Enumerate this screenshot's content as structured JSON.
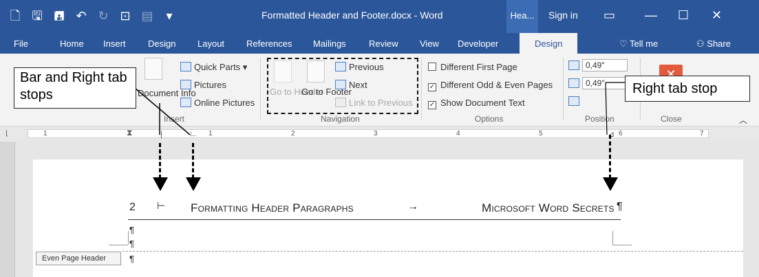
{
  "titlebar": {
    "doc_title": "Formatted Header and Footer.docx - Word",
    "context_tab": "Hea...",
    "sign_in": "Sign in"
  },
  "tabs": [
    "File",
    "Home",
    "Insert",
    "Design",
    "Layout",
    "References",
    "Mailings",
    "Review",
    "View",
    "Developer",
    "Design"
  ],
  "tell_me": "Tell me",
  "share": "Share",
  "ribbon": {
    "insert_group": {
      "doc_info": "Document Info",
      "quick_parts": "Quick Parts",
      "pictures": "Pictures",
      "online_pictures": "Online Pictures",
      "label": "Insert"
    },
    "navigation_group": {
      "go_to_header": "Go to Header",
      "go_to_footer": "Go to Footer",
      "previous": "Previous",
      "next": "Next",
      "link_to_previous": "Link to Previous",
      "label": "Navigation"
    },
    "options_group": {
      "different_first_page": "Different First Page",
      "different_odd_even": "Different Odd & Even Pages",
      "show_document_text": "Show Document Text",
      "different_first_page_checked": false,
      "different_odd_even_checked": true,
      "show_document_text_checked": true,
      "label": "Options"
    },
    "position_group": {
      "header_from_top": "0,49\"",
      "footer_from_bottom": "0,49\"",
      "label": "Position"
    },
    "close_group": {
      "label": "Close"
    }
  },
  "callouts": {
    "bar_right": "Bar and Right tab stops",
    "right": "Right tab stop"
  },
  "ruler_numbers": [
    "1",
    "1",
    "2",
    "3",
    "4",
    "5",
    "6",
    "7"
  ],
  "document": {
    "page_number": "2",
    "header_left": "Formatting Header Paragraphs",
    "header_right": "Microsoft Word Secrets",
    "pilcrow": "¶",
    "even_page_header_label": "Even Page Header"
  },
  "colors": {
    "word_blue": "#2b579a",
    "ribbon_bg": "#f3f3f3",
    "close_red": "#e35a3c"
  }
}
